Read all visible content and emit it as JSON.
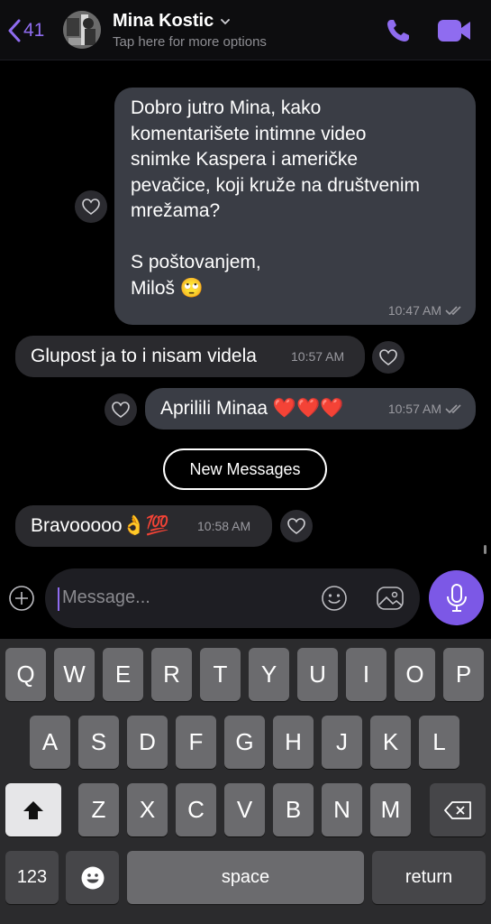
{
  "header": {
    "back_count": "41",
    "contact_name": "Mina Kostic",
    "subtitle": "Tap here for more options"
  },
  "messages": [
    {
      "direction": "outgoing",
      "text": "Dobro jutro Mina, kako\nkomentarišete intimne video\nsnimke Kaspera i američke\npevačice, koji kruže na društvenim\nmrežama?\n\nS poštovanjem,\nMiloš 🙄",
      "time": "10:47 AM",
      "status": "read"
    },
    {
      "direction": "incoming",
      "text": "Glupost ja to i nisam videla",
      "time": "10:57 AM"
    },
    {
      "direction": "outgoing",
      "text": "Aprilili Minaa ❤️❤️❤️",
      "time": "10:57 AM",
      "status": "read"
    },
    {
      "direction": "incoming",
      "text": "Bravooooo👌💯",
      "time": "10:58 AM"
    }
  ],
  "new_messages_label": "New Messages",
  "composer": {
    "placeholder": "Message..."
  },
  "keyboard": {
    "row1": [
      "Q",
      "W",
      "E",
      "R",
      "T",
      "Y",
      "U",
      "I",
      "O",
      "P"
    ],
    "row2": [
      "A",
      "S",
      "D",
      "F",
      "G",
      "H",
      "J",
      "K",
      "L"
    ],
    "row3": [
      "Z",
      "X",
      "C",
      "V",
      "B",
      "N",
      "M"
    ],
    "numbers_label": "123",
    "space_label": "space",
    "return_label": "return"
  },
  "colors": {
    "accent": "#7c58e6",
    "outgoing_bubble": "#3a3d45",
    "incoming_bubble": "#2a2a2e"
  }
}
